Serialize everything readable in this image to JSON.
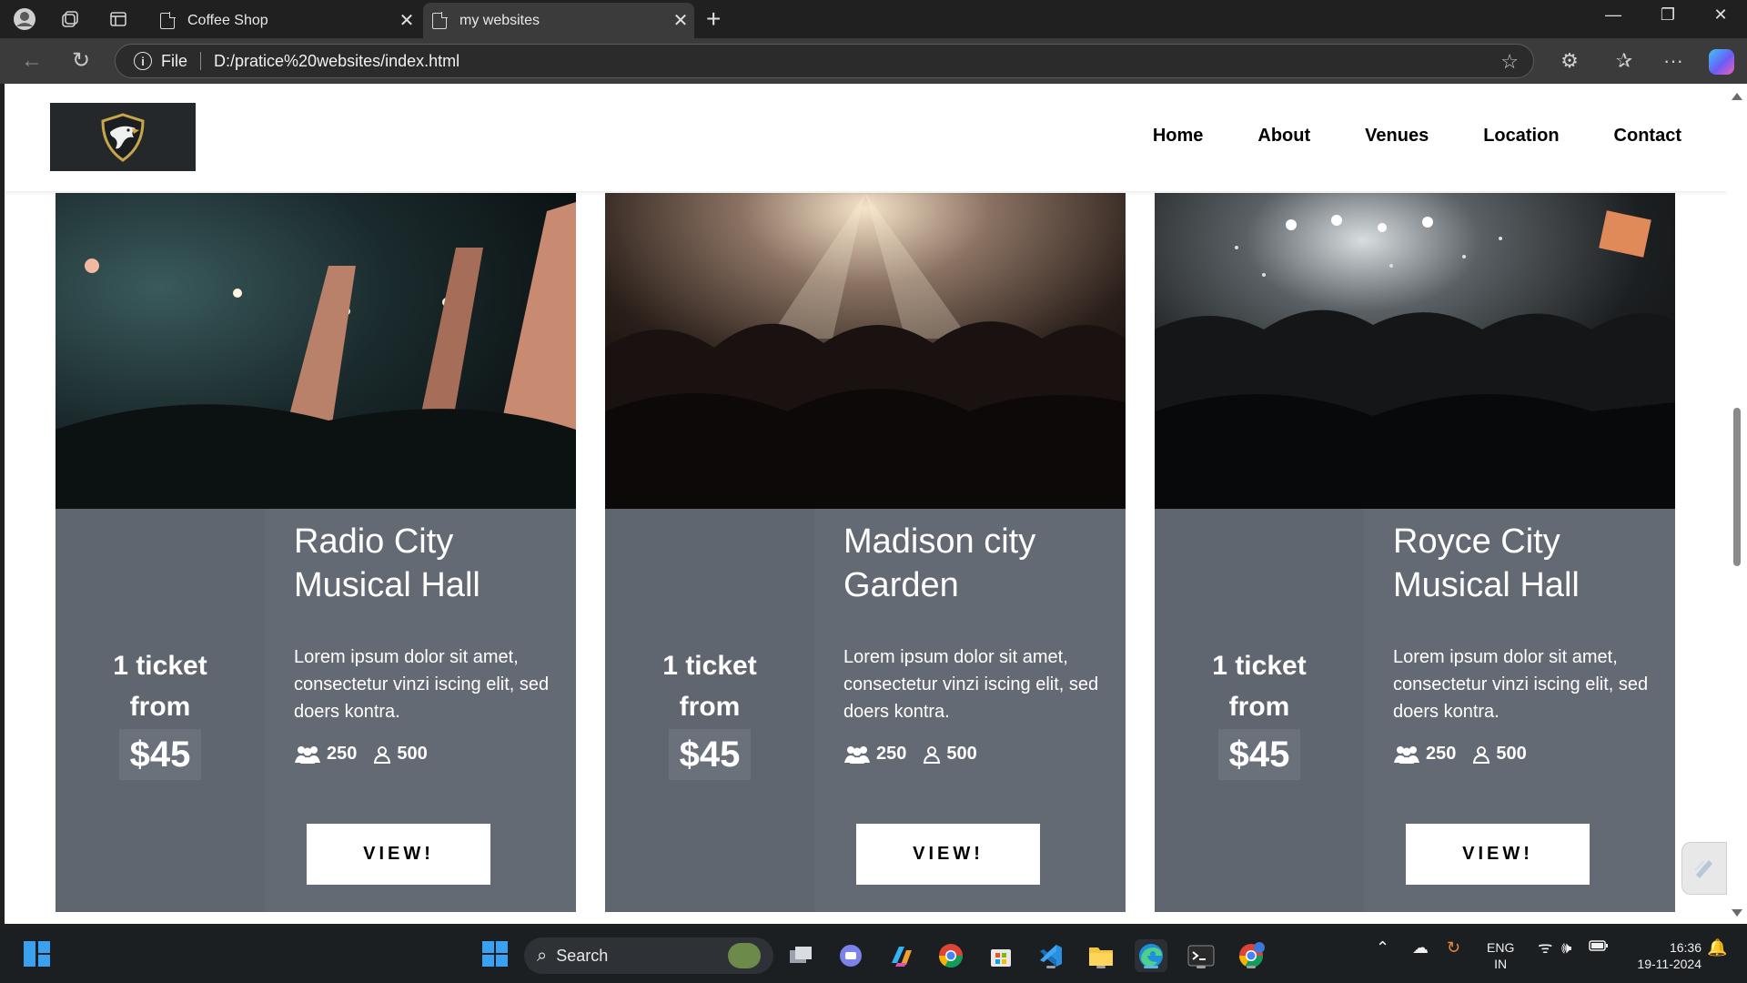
{
  "browser": {
    "tabs": [
      {
        "label": "Coffee Shop",
        "active": false
      },
      {
        "label": "my websites",
        "active": true
      }
    ],
    "address": {
      "scheme_label": "File",
      "url": "D:/pratice%20websites/index.html"
    }
  },
  "site": {
    "nav": [
      "Home",
      "About",
      "Venues",
      "Location",
      "Contact"
    ]
  },
  "cards": [
    {
      "name_line1": "Radio City",
      "name_line2": "Musical Hall",
      "ticket_line1": "1 ticket",
      "ticket_line2": "from",
      "price": "$45",
      "description": "Lorem ipsum dolor sit amet, consectetur vinzi iscing elit, sed doers kontra.",
      "stat_group": "250",
      "stat_person": "500",
      "button": "VIEW!"
    },
    {
      "name_line1": "Madison city",
      "name_line2": "Garden",
      "ticket_line1": "1 ticket",
      "ticket_line2": "from",
      "price": "$45",
      "description": "Lorem ipsum dolor sit amet, consectetur vinzi iscing elit, sed doers kontra.",
      "stat_group": "250",
      "stat_person": "500",
      "button": "VIEW!"
    },
    {
      "name_line1": "Royce City",
      "name_line2": "Musical Hall",
      "ticket_line1": "1 ticket",
      "ticket_line2": "from",
      "price": "$45",
      "description": "Lorem ipsum dolor sit amet, consectetur vinzi iscing elit, sed doers kontra.",
      "stat_group": "250",
      "stat_person": "500",
      "button": "VIEW!"
    }
  ],
  "taskbar": {
    "search_label": "Search",
    "language_line1": "ENG",
    "language_line2": "IN",
    "time": "16:36",
    "date": "19-11-2024"
  },
  "colors": {
    "card_bg": "#636a74",
    "logo_bg": "#24282b",
    "accent_blue": "#3aa0f0"
  }
}
